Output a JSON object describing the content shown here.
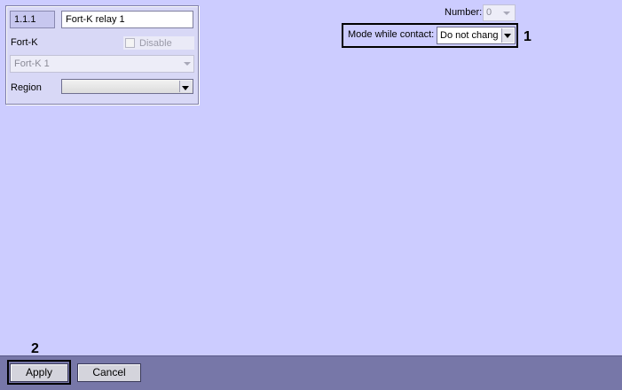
{
  "panel": {
    "id_value": "1.1.1",
    "name_value": "Fort-K relay 1",
    "fortk_label": "Fort-K",
    "disable_label": "Disable",
    "fortk_select_value": "Fort-K 1",
    "region_label": "Region",
    "region_value": ""
  },
  "settings": {
    "number_label": "Number:",
    "number_value": "0",
    "mode_label": "Mode while contact:",
    "mode_value": "Do not chang"
  },
  "callouts": {
    "mode": "1",
    "apply": "2"
  },
  "footer": {
    "apply_label": "Apply",
    "cancel_label": "Cancel"
  }
}
